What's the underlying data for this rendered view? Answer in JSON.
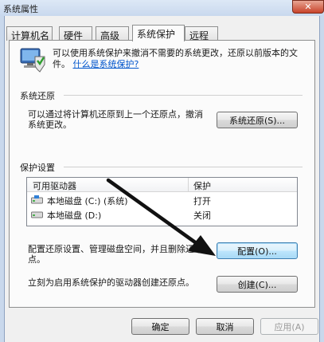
{
  "window": {
    "title": "系统属性",
    "close_label": "✕"
  },
  "tabs": [
    {
      "label": "计算机名",
      "active": false
    },
    {
      "label": "硬件",
      "active": false
    },
    {
      "label": "高级",
      "active": false
    },
    {
      "label": "系统保护",
      "active": true
    },
    {
      "label": "远程",
      "active": false
    }
  ],
  "intro": {
    "text": "可以使用系统保护来撤消不需要的系统更改，还原以前版本的文件。",
    "link": "什么是系统保护?"
  },
  "restore": {
    "title": "系统还原",
    "desc": "可以通过将计算机还原到上一个还原点，撤消系统更改。",
    "button": "系统还原(S)..."
  },
  "protection": {
    "title": "保护设置",
    "columns": [
      "可用驱动器",
      "保护"
    ],
    "drives": [
      {
        "name": "本地磁盘 (C:) (系统)",
        "status": "打开",
        "icon": "system-drive-icon"
      },
      {
        "name": "本地磁盘 (D:)",
        "status": "关闭",
        "icon": "drive-icon"
      }
    ],
    "config_desc": "配置还原设置、管理磁盘空间，并且删除还原点。",
    "config_button": "配置(O)...",
    "create_desc": "立刻为启用系统保护的驱动器创建还原点。",
    "create_button": "创建(C)..."
  },
  "footer": {
    "ok": "确定",
    "cancel": "取消",
    "apply": "应用(A)"
  },
  "colors": {
    "accent": "#3c7fb1",
    "link": "#0055cc",
    "close": "#c8432a"
  }
}
